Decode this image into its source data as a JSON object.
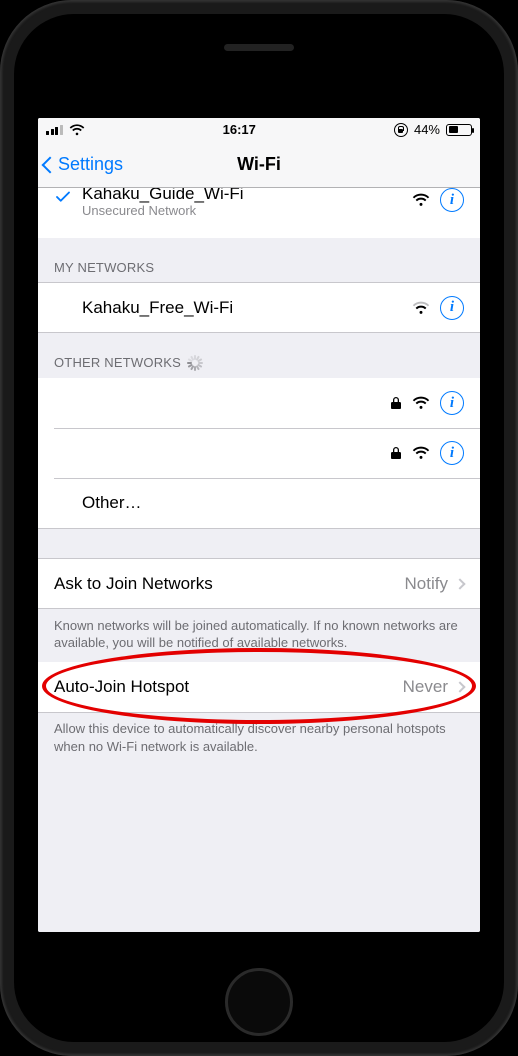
{
  "status_bar": {
    "time": "16:17",
    "battery_percent": "44%",
    "battery_fill_pct": 44
  },
  "nav": {
    "back_label": "Settings",
    "title": "Wi-Fi"
  },
  "connected_network": {
    "name": "Kahaku_Guide_Wi-Fi",
    "subtitle": "Unsecured Network"
  },
  "my_networks": {
    "header": "MY NETWORKS",
    "items": [
      {
        "name": "Kahaku_Free_Wi-Fi",
        "locked": false,
        "signal": "medium"
      }
    ]
  },
  "other_networks": {
    "header": "OTHER NETWORKS",
    "items": [
      {
        "name": "",
        "locked": true,
        "signal": "strong"
      },
      {
        "name": "",
        "locked": true,
        "signal": "strong"
      }
    ],
    "other_label": "Other…"
  },
  "ask_join": {
    "label": "Ask to Join Networks",
    "value": "Notify",
    "footer": "Known networks will be joined automatically. If no known networks are available, you will be notified of available networks."
  },
  "auto_hotspot": {
    "label": "Auto-Join Hotspot",
    "value": "Never",
    "footer": "Allow this device to automatically discover nearby personal hotspots when no Wi-Fi network is available."
  }
}
